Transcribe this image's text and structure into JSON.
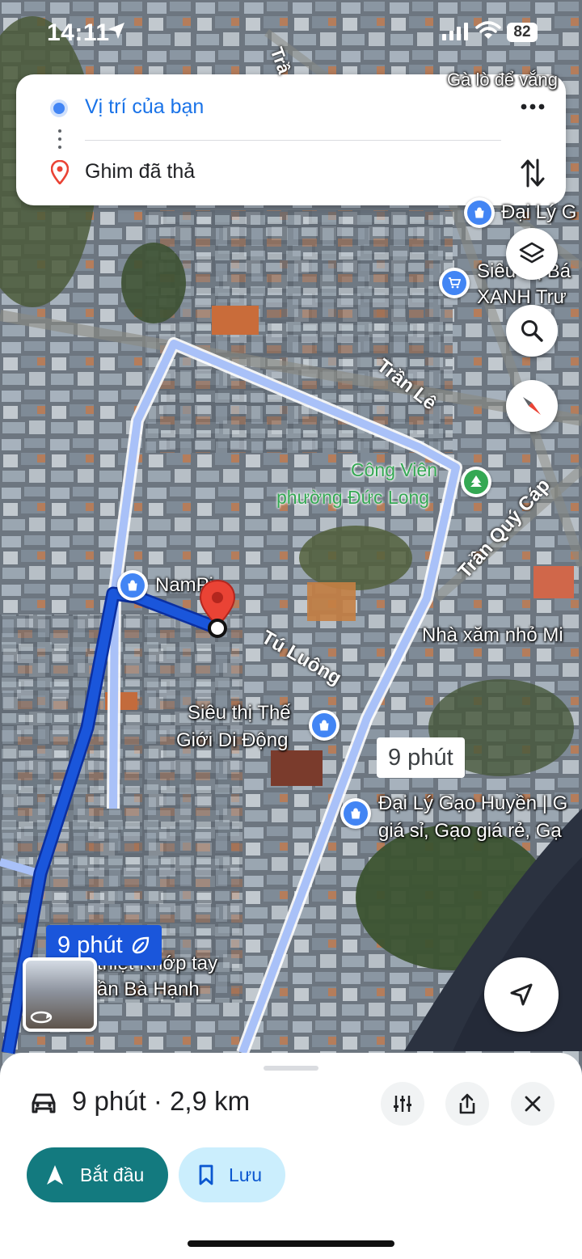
{
  "status_bar": {
    "time": "14:11",
    "battery": "82"
  },
  "directions": {
    "origin": "Vị trí của bạn",
    "destination": "Ghim đã thả"
  },
  "map": {
    "streets": [
      "Trần Lê",
      "Trần Quý Cáp",
      "Tú Luông",
      "Trầ"
    ],
    "places": {
      "park_line1": "Công Viên",
      "park_line2": "phường Đức Long",
      "nam": "NamPi",
      "sieuthi_line1": "Siêu thị Thế",
      "sieuthi_line2": "Giới Di Động",
      "daily_gao_line1": "Đại Lý Gạo Huyền | G",
      "daily_gao_line2": "giá sỉ, Gạo giá rẻ, Gạ",
      "nha_xam": "Nhà xăm nhỏ Mi",
      "daily_top": "Đại Lý G",
      "sieuthi_top_line1": "Siêu thị Bá",
      "sieuthi_top_line2": "XANH Trư",
      "top_right": "Gà lò để vắng",
      "khop_line1": "thiệt Khớp tay",
      "khop_line2": "ần Bà Hạnh"
    },
    "route_labels": {
      "alternate": "9 phút",
      "main": "9 phút"
    }
  },
  "sheet": {
    "summary": "9 phút · 2,9 km",
    "start_label": "Bắt đầu",
    "save_label": "Lưu"
  },
  "colors": {
    "route_main": "#1a56db",
    "route_alt": "#a9c1f8",
    "start_button": "#137a7f",
    "save_button": "#cbeefd",
    "pin": "#ea4335"
  }
}
